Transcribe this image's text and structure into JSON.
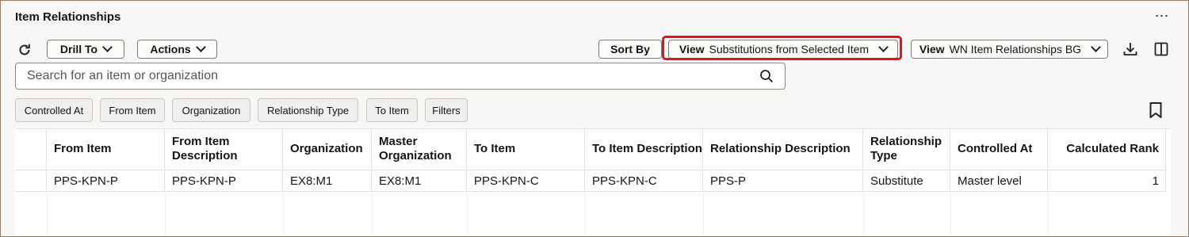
{
  "header": {
    "title": "Item Relationships",
    "more_label": "⋯"
  },
  "toolbar": {
    "drill_to": "Drill To",
    "actions": "Actions",
    "sort_by": "Sort By",
    "view1_prefix": "View",
    "view1_value": "Substitutions from Selected Item",
    "view2_prefix": "View",
    "view2_value": "WN Item Relationships BG"
  },
  "search": {
    "placeholder": "Search for an item or organization"
  },
  "filters": [
    "Controlled At",
    "From Item",
    "Organization",
    "Relationship Type",
    "To Item",
    "Filters"
  ],
  "table": {
    "columns": [
      "From Item",
      "From Item Description",
      "Organization",
      "Master Organization",
      "To Item",
      "To Item Description",
      "Relationship Description",
      "Relationship Type",
      "Controlled At",
      "Calculated Rank"
    ],
    "rows": [
      [
        "PPS-KPN-P",
        "PPS-KPN-P",
        "EX8:M1",
        "EX8:M1",
        "PPS-KPN-C",
        "PPS-KPN-C",
        "PPS-P",
        "Substitute",
        "Master level",
        "1"
      ]
    ]
  },
  "colors": {
    "highlight": "#e0141e",
    "background": "#f7f6f4"
  }
}
